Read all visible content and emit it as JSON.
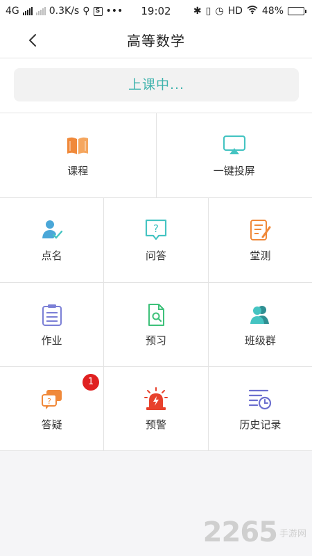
{
  "status_bar": {
    "network": "4G",
    "speed": "0.3K/s",
    "time": "19:02",
    "network_type": "HD",
    "battery": "48%",
    "battery_level": 0.48,
    "icons": [
      "signal-icon",
      "usb-icon",
      "sim-icon",
      "more-icon",
      "bluetooth-icon",
      "vibrate-icon",
      "alarm-icon",
      "wifi-icon",
      "battery-icon"
    ]
  },
  "header": {
    "title": "高等数学"
  },
  "banner": {
    "text": "上课中..."
  },
  "menu": [
    {
      "label": "课程",
      "icon": "book-icon"
    },
    {
      "label": "一键投屏",
      "icon": "screen-cast-icon"
    },
    {
      "label": "点名",
      "icon": "roll-call-icon"
    },
    {
      "label": "问答",
      "icon": "question-chat-icon"
    },
    {
      "label": "堂测",
      "icon": "quiz-icon"
    },
    {
      "label": "作业",
      "icon": "homework-icon"
    },
    {
      "label": "预习",
      "icon": "preview-doc-icon"
    },
    {
      "label": "班级群",
      "icon": "class-group-icon"
    },
    {
      "label": "答疑",
      "icon": "qa-bubbles-icon",
      "badge": "1"
    },
    {
      "label": "预警",
      "icon": "alarm-light-icon"
    },
    {
      "label": "历史记录",
      "icon": "history-icon"
    }
  ],
  "watermark": {
    "number": "2265",
    "text": "手游网"
  },
  "colors": {
    "accent": "#3fb3ad",
    "orange": "#f0893a",
    "badge": "#e02020",
    "purple": "#6c6fcf"
  }
}
